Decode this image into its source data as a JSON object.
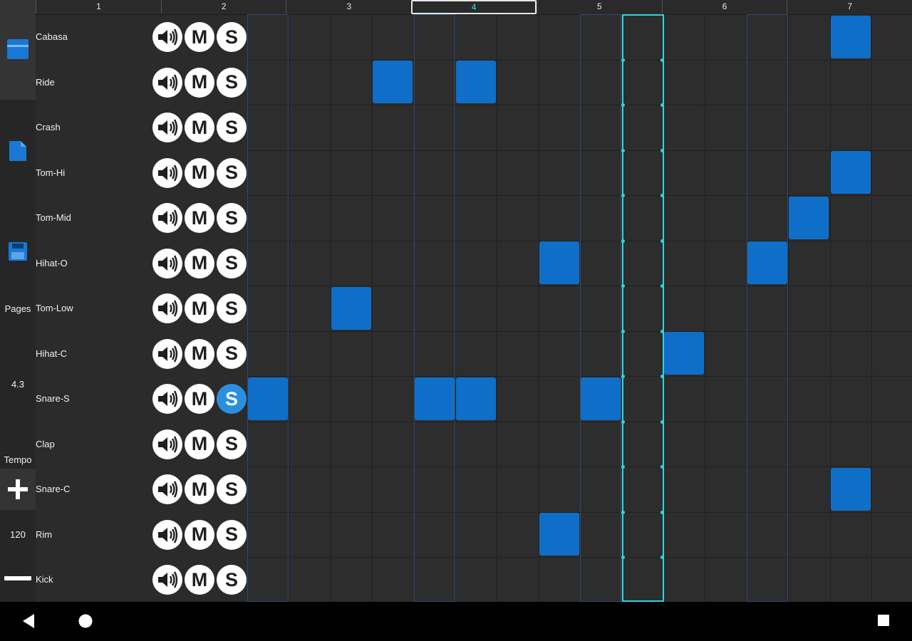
{
  "ruler": {
    "bars": [
      "1",
      "2",
      "3",
      "4",
      "5",
      "6",
      "7"
    ],
    "current_bar": 4
  },
  "side_panel": {
    "pages_label": "Pages",
    "page_value": "4.3",
    "tempo_label": "Tempo",
    "tempo_value": "120"
  },
  "tracks": [
    {
      "name": "Cabasa",
      "solo": false,
      "steps": [
        14
      ]
    },
    {
      "name": "Ride",
      "solo": false,
      "steps": [
        3,
        5
      ]
    },
    {
      "name": "Crash",
      "solo": false,
      "steps": []
    },
    {
      "name": "Tom-Hi",
      "solo": false,
      "steps": [
        14
      ]
    },
    {
      "name": "Tom-Mid",
      "solo": false,
      "steps": [
        13
      ]
    },
    {
      "name": "Hihat-O",
      "solo": false,
      "steps": [
        7,
        12
      ]
    },
    {
      "name": "Tom-Low",
      "solo": false,
      "steps": [
        2
      ]
    },
    {
      "name": "Hihat-C",
      "solo": false,
      "steps": [
        10
      ]
    },
    {
      "name": "Snare-S",
      "solo": true,
      "steps": [
        0,
        4,
        5,
        8
      ]
    },
    {
      "name": "Clap",
      "solo": false,
      "steps": []
    },
    {
      "name": "Snare-C",
      "solo": false,
      "steps": [
        14
      ]
    },
    {
      "name": "Rim",
      "solo": false,
      "steps": [
        7
      ]
    },
    {
      "name": "Kick",
      "solo": false,
      "steps": []
    }
  ],
  "mute_label": "M",
  "solo_label": "S",
  "grid": {
    "visible_steps": 16,
    "playhead_step": 9
  },
  "colors": {
    "active_step": "#0f6fc8",
    "playhead": "#2dd6dc",
    "solo_on": "#2b8fe0"
  },
  "icons": {
    "side": [
      "song-icon",
      "file-icon",
      "save-icon",
      "plus-icon",
      "minus-icon"
    ],
    "nav": [
      "back-icon",
      "home-icon",
      "recents-icon"
    ]
  }
}
